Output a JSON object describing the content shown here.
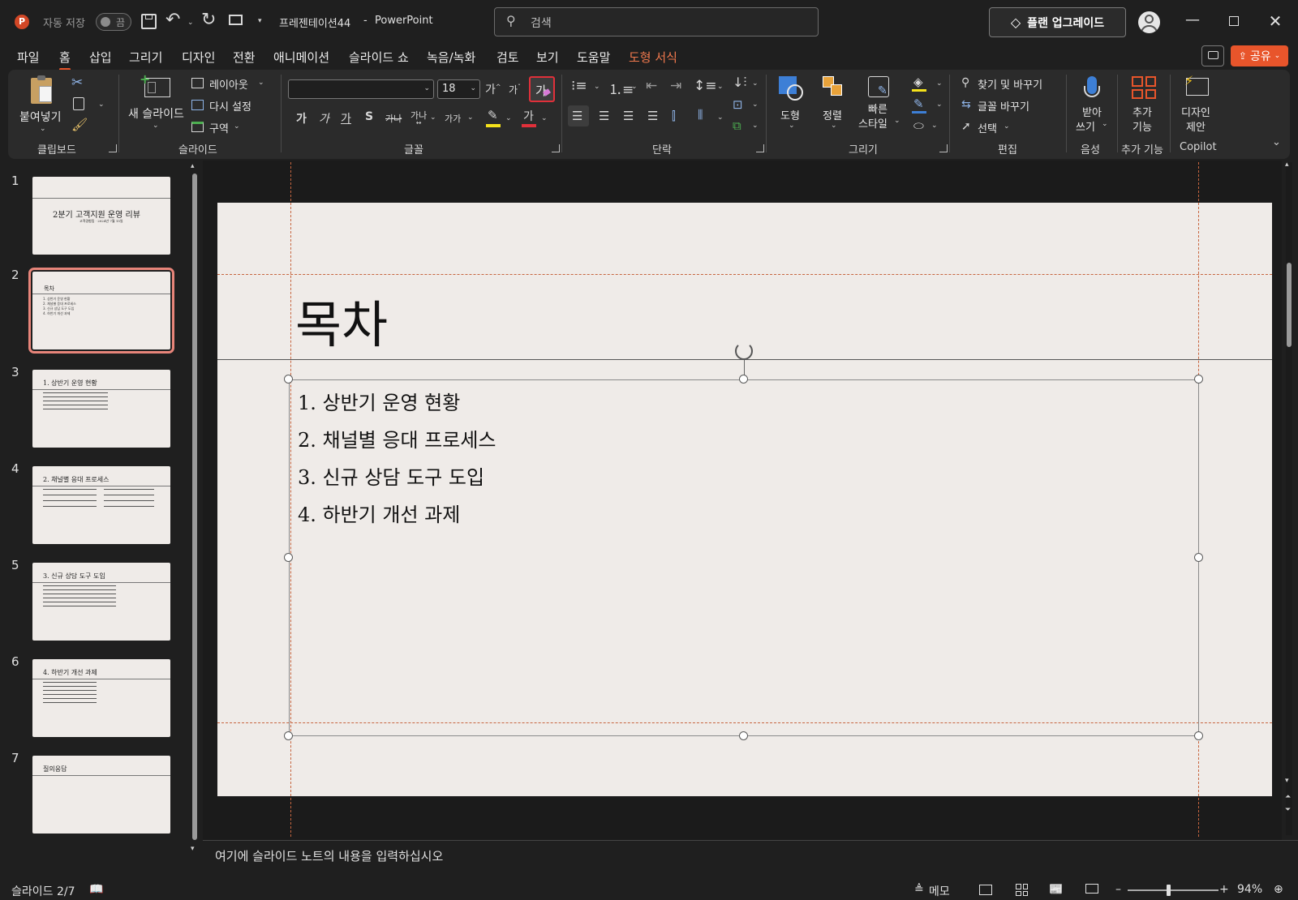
{
  "titlebar": {
    "autosave_label": "자동 저장",
    "autosave_state": "끔",
    "file_name": "프레젠테이션44",
    "separator": "-",
    "app_name": "PowerPoint",
    "search_placeholder": "검색",
    "upgrade_label": "플랜 업그레이드"
  },
  "menu": {
    "tabs": [
      "파일",
      "홈",
      "삽입",
      "그리기",
      "디자인",
      "전환",
      "애니메이션",
      "슬라이드 쇼",
      "녹음/녹화",
      "검토",
      "보기",
      "도움말",
      "도형 서식"
    ],
    "active_tab": "홈",
    "share_label": "공유"
  },
  "ribbon": {
    "clipboard": {
      "paste_label": "붙여넣기",
      "group_label": "클립보드"
    },
    "slides": {
      "new_slide_label": "새 슬라이드",
      "layout_label": "레이아웃",
      "reset_label": "다시 설정",
      "section_label": "구역",
      "group_label": "슬라이드"
    },
    "font": {
      "font_name": "",
      "font_size": "18",
      "group_label": "글꼴"
    },
    "paragraph": {
      "group_label": "단락"
    },
    "drawing": {
      "shapes_label": "도형",
      "arrange_label": "정렬",
      "quick_styles_line1": "빠른",
      "quick_styles_line2": "스타일",
      "group_label": "그리기"
    },
    "editing": {
      "find_replace_label": "찾기 및 바꾸기",
      "replace_fonts_label": "글꼴 바꾸기",
      "select_label": "선택",
      "group_label": "편집"
    },
    "voice": {
      "dictate_line1": "받아",
      "dictate_line2": "쓰기",
      "group_label": "음성"
    },
    "addins": {
      "line1": "추가",
      "line2": "기능",
      "group_label": "추가 기능"
    },
    "copilot": {
      "designer_line1": "디자인",
      "designer_line2": "제안",
      "group_label": "Copilot"
    }
  },
  "thumbnails": [
    {
      "number": "1",
      "title": "2분기 고객지원 운영 리뷰",
      "subtitle": "고객경험팀 · 2024년 7월 15일"
    },
    {
      "number": "2",
      "title": "목차",
      "lines": [
        "1. 상반기 운영 현황",
        "2. 채널별 응대 프로세스",
        "3. 신규 상담 도구 도입",
        "4. 하반기 개선 과제"
      ]
    },
    {
      "number": "3",
      "title": "1. 상반기 운영 현황"
    },
    {
      "number": "4",
      "title": "2. 채널별 응대 프로세스"
    },
    {
      "number": "5",
      "title": "3. 신규 상담 도구 도입"
    },
    {
      "number": "6",
      "title": "4. 하반기 개선 과제"
    },
    {
      "number": "7",
      "title": "질의응답"
    }
  ],
  "slide": {
    "title": "목차",
    "bullets": [
      "1. 상반기 운영 현황",
      "2. 채널별 응대 프로세스",
      "3. 신규 상담 도구 도입",
      "4. 하반기 개선 과제"
    ]
  },
  "notes": {
    "placeholder": "여기에 슬라이드 노트의 내용을 입력하십시오"
  },
  "status": {
    "slide_indicator": "슬라이드 2/7",
    "notes_label": "메모",
    "zoom": "94%"
  },
  "colors": {
    "accent": "#e8552b",
    "share_button": "#e8552b",
    "highlighted_button_border": "#e0303a",
    "slide_bg": "#efebe8"
  }
}
